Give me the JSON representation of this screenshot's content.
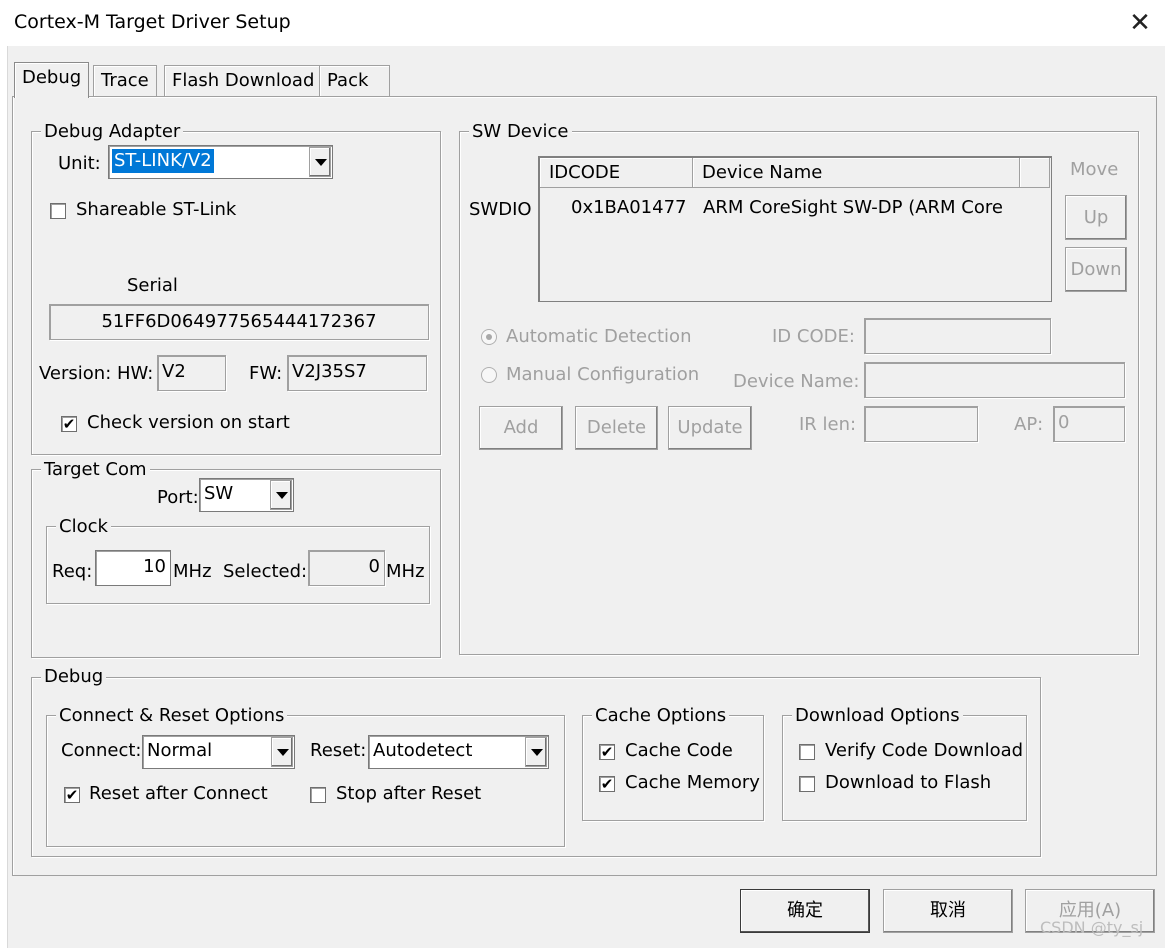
{
  "window": {
    "title": "Cortex-M Target Driver Setup",
    "close": "✕"
  },
  "tabs": [
    "Debug",
    "Trace",
    "Flash Download",
    "Pack"
  ],
  "debug_adapter": {
    "title": "Debug Adapter",
    "unit_label": "Unit:",
    "unit_value": "ST-LINK/V2",
    "shareable_label": "Shareable ST-Link",
    "shareable_checked": false,
    "serial_label": "Serial",
    "serial_value": "51FF6D064977565444172367",
    "version_label": "Version: HW:",
    "hw_value": "V2",
    "fw_label": "FW:",
    "fw_value": "V2J35S7",
    "check_version_label": "Check version on start",
    "check_version_checked": true,
    "check_mark": "✔"
  },
  "target_com": {
    "title": "Target Com",
    "port_label": "Port:",
    "port_value": "SW",
    "clock_title": "Clock",
    "req_label": "Req:",
    "req_value": "10",
    "mhz1": "MHz",
    "selected_label": "Selected:",
    "selected_value": "0",
    "mhz2": "MHz"
  },
  "sw_device": {
    "title": "SW Device",
    "row_label": "SWDIO",
    "columns": [
      "IDCODE",
      "Device Name"
    ],
    "rows": [
      {
        "idcode": "0x1BA01477",
        "name": "ARM CoreSight SW-DP (ARM Core"
      }
    ],
    "move_label": "Move",
    "up_label": "Up",
    "down_label": "Down",
    "auto_detect_label": "Automatic Detection",
    "manual_config_label": "Manual Configuration",
    "id_code_label": "ID CODE:",
    "device_name_label": "Device Name:",
    "add_label": "Add",
    "delete_label": "Delete",
    "update_label": "Update",
    "ir_len_label": "IR len:",
    "ap_label": "AP:",
    "ap_value": "0"
  },
  "debug": {
    "title": "Debug",
    "connect_reset": {
      "title": "Connect & Reset Options",
      "connect_label": "Connect:",
      "connect_value": "Normal",
      "reset_label": "Reset:",
      "reset_value": "Autodetect",
      "reset_after_connect_label": "Reset after Connect",
      "reset_after_connect_checked": true,
      "stop_after_reset_label": "Stop after Reset",
      "stop_after_reset_checked": false
    },
    "cache": {
      "title": "Cache Options",
      "cache_code_label": "Cache Code",
      "cache_code_checked": true,
      "cache_memory_label": "Cache Memory",
      "cache_memory_checked": true
    },
    "download": {
      "title": "Download Options",
      "verify_label": "Verify Code Download",
      "verify_checked": false,
      "download_flash_label": "Download to Flash",
      "download_flash_checked": false
    }
  },
  "footer": {
    "ok": "确定",
    "cancel": "取消",
    "apply": "应用(A)"
  },
  "watermark": "CSDN @ty_sj",
  "colors": {
    "selection": "#0078d7",
    "background": "#f0f0f0",
    "disabled_text": "#a0a0a0"
  }
}
